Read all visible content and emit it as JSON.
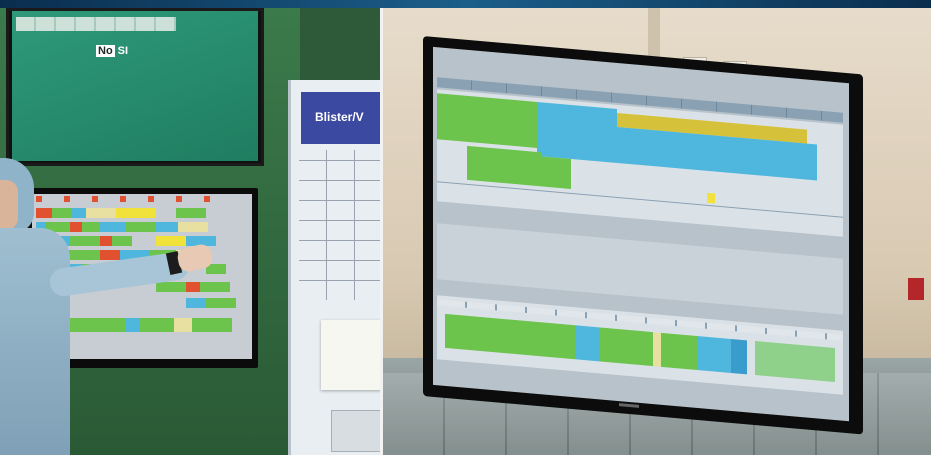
{
  "left_photo": {
    "top_monitor": {
      "box_label": "No",
      "label_suffix": "SI"
    },
    "whiteboard": {
      "header_text": "Blister/V"
    }
  },
  "right_photo": {
    "monitor": {
      "schedule_title": "",
      "details_title": "",
      "utilization_title": ""
    }
  },
  "colors": {
    "schedule_green": "#6cc44c",
    "schedule_blue": "#4fb7dd",
    "schedule_yellow": "#d6c23a",
    "status_red": "#e1512f",
    "screen_bg": "#b7c2ca"
  }
}
